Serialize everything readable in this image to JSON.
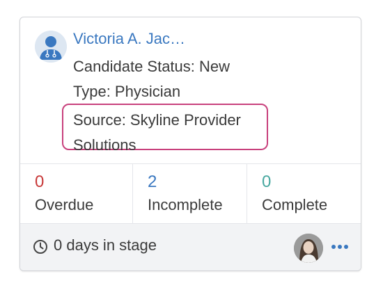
{
  "candidate": {
    "name": "Victoria A. Jac…",
    "status": "Candidate Status: New",
    "type": "Type: Physician",
    "source": "Source: Skyline Provider Solutions"
  },
  "stats": {
    "overdue": {
      "count": "0",
      "label": "Overdue",
      "color": "#c83a3a"
    },
    "incomplete": {
      "count": "2",
      "label": "Incomplete",
      "color": "#3a78c0"
    },
    "complete": {
      "count": "0",
      "label": "Complete",
      "color": "#48a8a0"
    }
  },
  "footer": {
    "days_in_stage": "0 days in stage"
  },
  "colors": {
    "link": "#3a78c0",
    "highlight_border": "#c8407c",
    "more_dots": "#3a78c0"
  },
  "icons": {
    "avatar": "doctor-avatar-icon",
    "clock": "clock-icon",
    "more": "more-horizontal-icon"
  }
}
